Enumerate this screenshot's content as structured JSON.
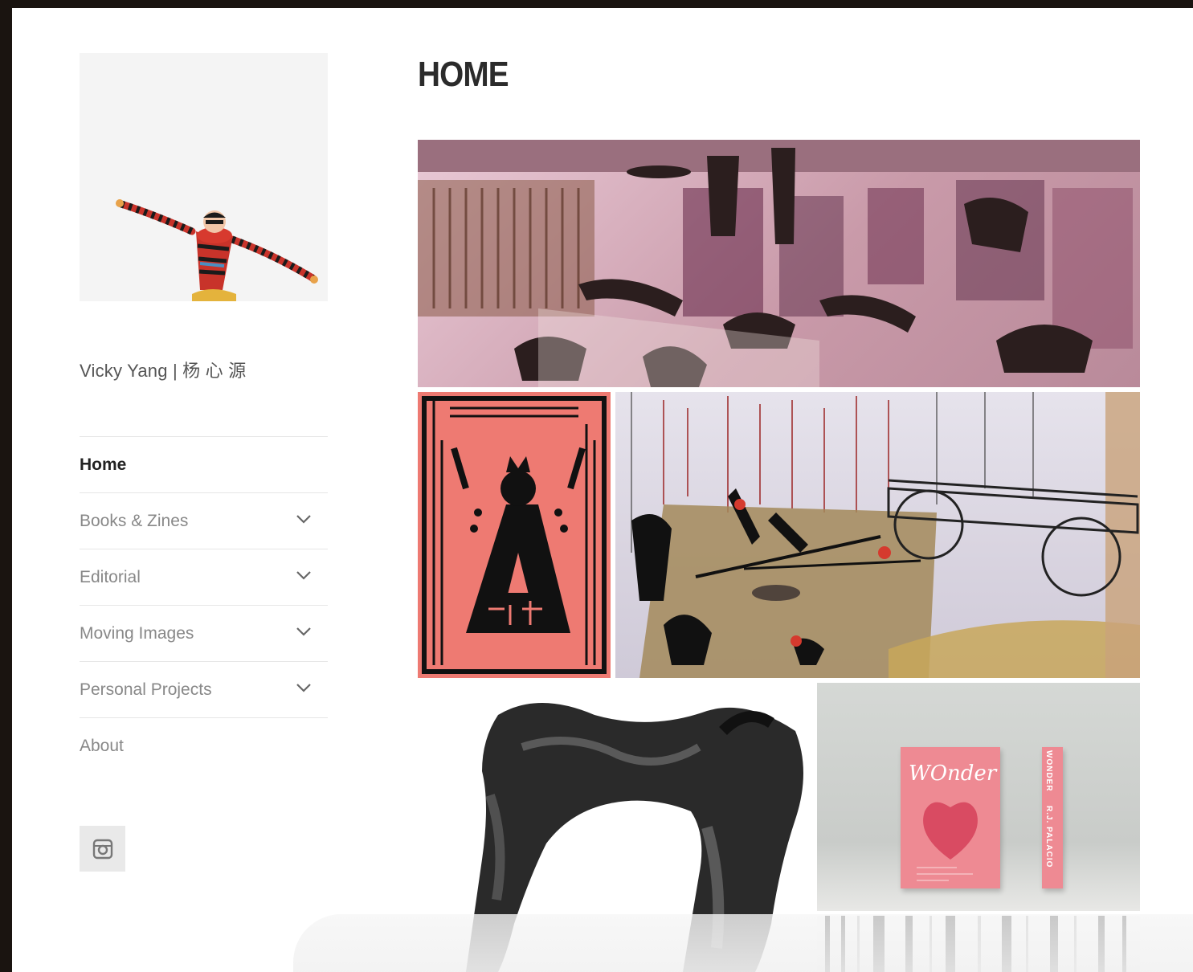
{
  "site": {
    "title": "Vicky Yang | 杨 心 源"
  },
  "nav": {
    "items": [
      {
        "label": "Home",
        "active": true,
        "has_submenu": false
      },
      {
        "label": "Books & Zines",
        "active": false,
        "has_submenu": true
      },
      {
        "label": "Editorial",
        "active": false,
        "has_submenu": true
      },
      {
        "label": "Moving Images",
        "active": false,
        "has_submenu": true
      },
      {
        "label": "Personal Projects",
        "active": false,
        "has_submenu": true
      },
      {
        "label": "About",
        "active": false,
        "has_submenu": false
      }
    ]
  },
  "social": {
    "icon": "instagram-icon"
  },
  "main": {
    "page_title": "HOME",
    "gallery": [
      {
        "name": "gallery-image-room-figures"
      },
      {
        "name": "gallery-image-poster-red"
      },
      {
        "name": "gallery-image-cart-scene"
      },
      {
        "name": "gallery-image-ink-figure"
      },
      {
        "name": "gallery-image-wonder-book"
      },
      {
        "name": "gallery-image-stripes"
      }
    ],
    "book_cover": {
      "title": "WOnder",
      "spine": "WONDER",
      "author": "R.J. PALACIO"
    }
  },
  "colors": {
    "frame": "#1a1410",
    "text_active": "#222222",
    "text_muted": "#888888"
  }
}
